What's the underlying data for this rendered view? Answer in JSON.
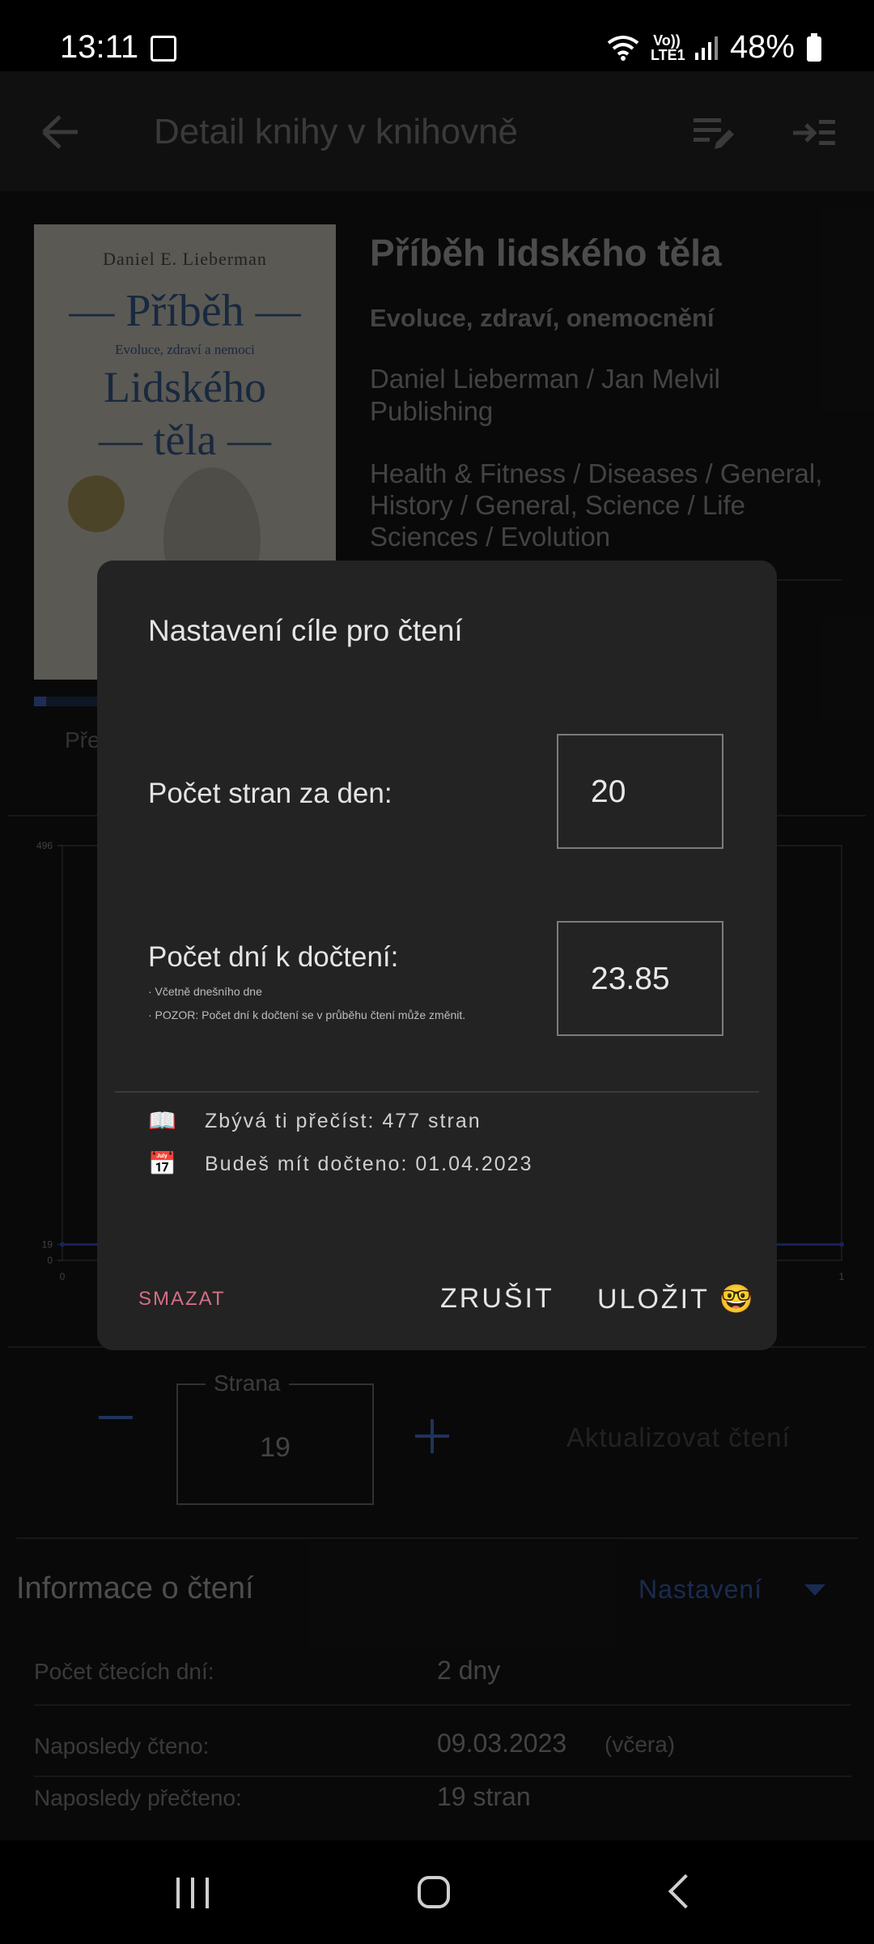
{
  "status_bar": {
    "time": "13:11",
    "network": "Vo)) LTE1",
    "battery": "48%",
    "icons": [
      "image-icon",
      "wifi-icon",
      "signal-icon",
      "battery-icon"
    ]
  },
  "app_bar": {
    "title": "Detail knihy v knihovně",
    "icons": [
      "back-arrow-icon",
      "edit-list-icon",
      "collapse-panel-icon"
    ]
  },
  "book": {
    "title": "Příběh lidského těla",
    "subtitle": "Evoluce, zdraví, onemocnění",
    "authors": "Daniel Lieberman / Jan Melvil Publishing",
    "categories": "Health & Fitness / Diseases / General, History / General, Science / Life Sciences / Evolution",
    "cover_caption": "Pře",
    "cover": {
      "author": "Daniel E. Lieberman",
      "title_line1": "— Příběh —",
      "subtitle": "Evoluce, zdraví a nemoci",
      "title_line2": "Lidského",
      "title_line3": "— těla —"
    },
    "progress_fraction": 0.04
  },
  "chart_data": {
    "type": "line",
    "y_ticks": [
      "496",
      "19",
      "0"
    ],
    "x_ticks": [
      "0",
      "1"
    ],
    "series": [
      {
        "values": [
          19,
          19
        ]
      }
    ],
    "ylim": [
      0,
      496
    ],
    "xlim": [
      0,
      1
    ],
    "colors": {
      "line": "#2b3fa8",
      "grid": "#2e2e2e"
    }
  },
  "page_control": {
    "legend": "Strana",
    "value": "19",
    "update_label": "Aktualizovat čtení"
  },
  "reading_info": {
    "title": "Informace o čtení",
    "settings_label": "Nastavení",
    "rows": [
      {
        "label": "Počet čtecích dní:",
        "value": "2 dny",
        "extra": ""
      },
      {
        "label": "Naposledy čteno:",
        "value": "09.03.2023",
        "extra": "(včera)"
      },
      {
        "label": "Naposledy přečteno:",
        "value": "19 stran",
        "extra": ""
      }
    ]
  },
  "dialog": {
    "title": "Nastavení cíle pro čtení",
    "pages_per_day_label": "Počet stran za den:",
    "pages_per_day_value": "20",
    "days_label": "Počet dní k dočtení:",
    "days_value": "23.85",
    "note1": "· Včetně dnešního dne",
    "note2": "· POZOR: Počet dní k dočtení se v průběhu čtení může změnit.",
    "info": [
      {
        "icon": "📖",
        "text": "Zbývá ti přečíst: 477 stran"
      },
      {
        "icon": "📅",
        "text": "Budeš mít dočteno: 01.04.2023"
      }
    ],
    "delete_label": "SMAZAT",
    "cancel_label": "ZRUŠIT",
    "save_label": "ULOŽIT 🤓",
    "colors": {
      "accent_delete": "#d46f86",
      "accent_link": "#2e4f94"
    }
  }
}
